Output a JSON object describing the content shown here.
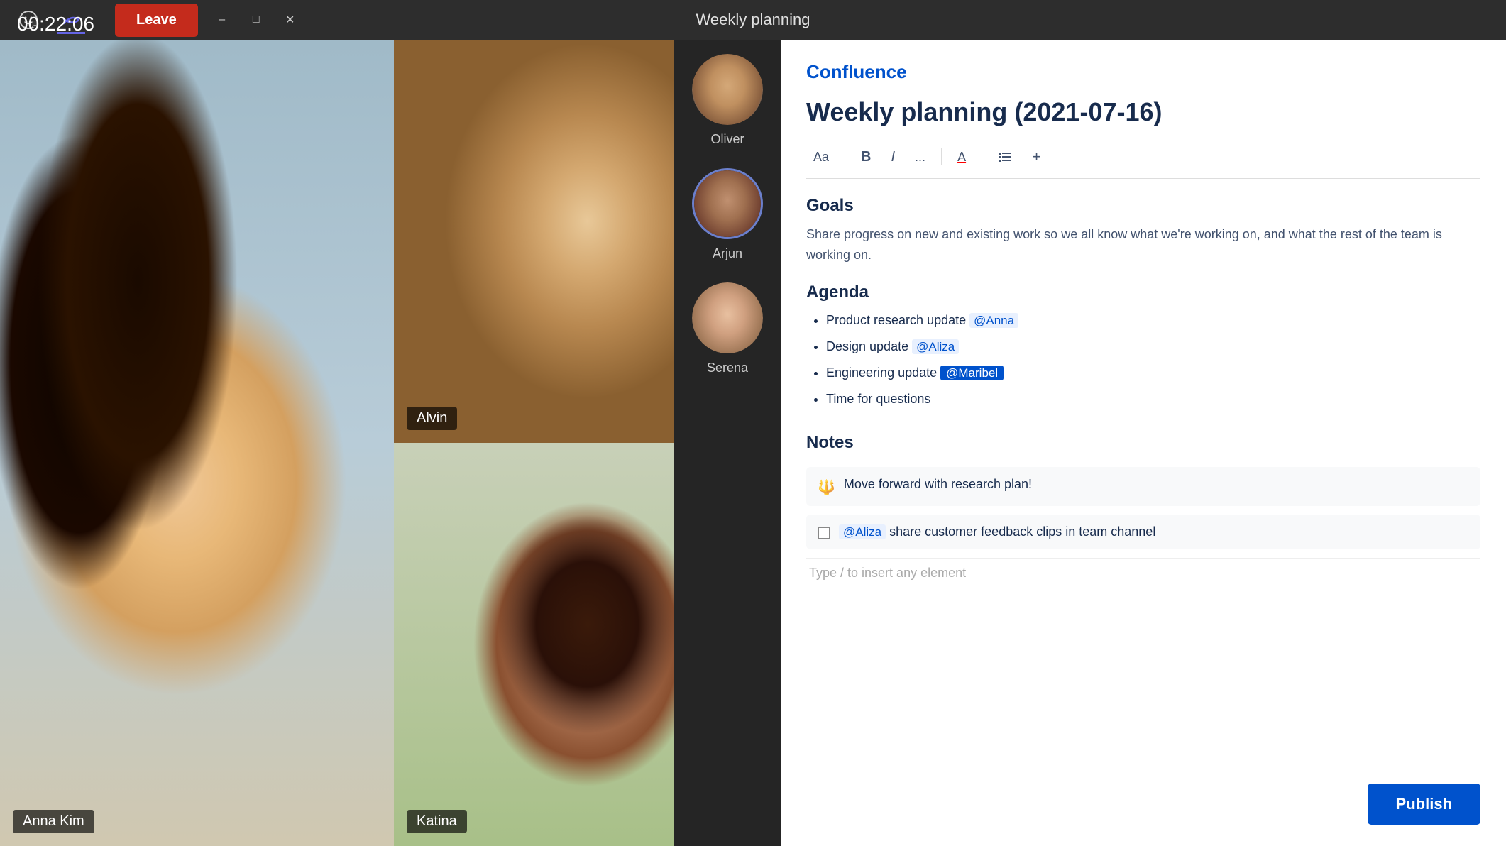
{
  "titlebar": {
    "title": "Weekly planning",
    "timer": "00:22:06",
    "leave_label": "Leave"
  },
  "toolbar": {
    "font_btn": "Aa",
    "bold_btn": "B",
    "italic_btn": "I",
    "more_btn": "...",
    "color_btn": "A",
    "list_btn": "☰",
    "add_btn": "+"
  },
  "confluence": {
    "app_name": "Confluence",
    "doc_title": "Weekly planning (2021-07-16)",
    "goals_heading": "Goals",
    "goals_text": "Share progress on new and existing work so we all know what we're working on, and what the rest of the team is working on.",
    "agenda_heading": "Agenda",
    "agenda_items": [
      {
        "text": "Product research update ",
        "mention": "@Anna",
        "mention_style": "plain"
      },
      {
        "text": "Design update ",
        "mention": "@Aliza",
        "mention_style": "plain"
      },
      {
        "text": "Engineering update ",
        "mention": "@Maribel",
        "mention_style": "highlight"
      },
      {
        "text": "Time for questions",
        "mention": "",
        "mention_style": "none"
      }
    ],
    "notes_heading": "Notes",
    "note1_icon": "🔱",
    "note1_text": "Move forward with research plan!",
    "note2_mention": "@Aliza",
    "note2_text": " share customer feedback clips in team channel",
    "placeholder_text": "Type / to insert any element",
    "publish_label": "Publish"
  },
  "participants": [
    {
      "name": "Oliver",
      "active": false
    },
    {
      "name": "Arjun",
      "active": true
    },
    {
      "name": "Serena",
      "active": false
    }
  ],
  "video_labels": {
    "anna": "Anna Kim",
    "alvin": "Alvin",
    "katina": "Katina"
  }
}
